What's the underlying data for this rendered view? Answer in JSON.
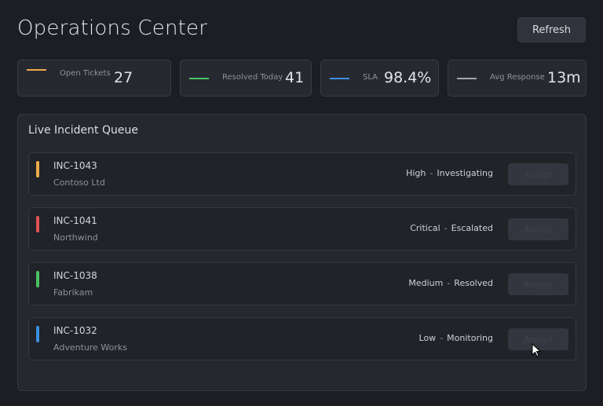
{
  "header": {
    "title": "Operations Center",
    "refresh_label": "Refresh"
  },
  "stats": [
    {
      "label": "Open Tickets",
      "value": "27",
      "color": "#f0a94a"
    },
    {
      "label": "Resolved Today",
      "value": "41",
      "color": "#4cc261"
    },
    {
      "label": "SLA",
      "value": "98.4%",
      "color": "#3d8fe0"
    },
    {
      "label": "Avg Response",
      "value": "13m",
      "color": "#a4a7ad"
    }
  ],
  "queue": {
    "title": "Live Incident Queue",
    "incidents": [
      {
        "id": "INC-1043",
        "client": "Contoso Ltd",
        "priority": "High",
        "separator": "-",
        "state": "Investigating",
        "color": "#f0a94a",
        "action": "Assign"
      },
      {
        "id": "INC-1041",
        "client": "Northwind",
        "priority": "Critical",
        "separator": "-",
        "state": "Escalated",
        "color": "#e05252",
        "action": "Assign"
      },
      {
        "id": "INC-1038",
        "client": "Fabrikam",
        "priority": "Medium",
        "separator": "-",
        "state": "Resolved",
        "color": "#4cc261",
        "action": "Assign"
      },
      {
        "id": "INC-1032",
        "client": "Adventure Works",
        "priority": "Low",
        "separator": "-",
        "state": "Monitoring",
        "color": "#3d8fe0",
        "action": "Assign"
      }
    ]
  }
}
